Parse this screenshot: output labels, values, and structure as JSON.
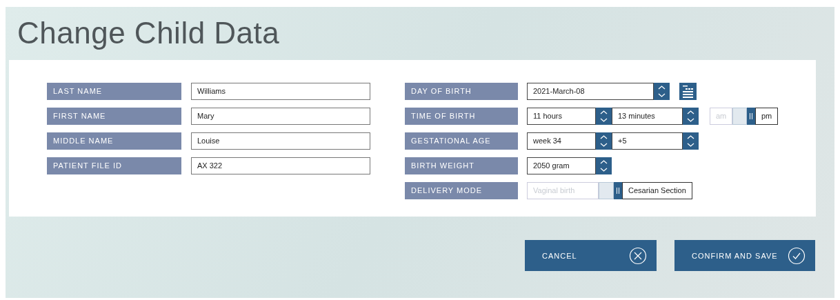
{
  "title": "Change Child Data",
  "left_fields": [
    {
      "label": "LAST NAME",
      "value": "Williams"
    },
    {
      "label": "FIRST NAME",
      "value": "Mary"
    },
    {
      "label": "MIDDLE NAME",
      "value": "Louise"
    },
    {
      "label": "PATIENT FILE ID",
      "value": "AX 322"
    }
  ],
  "right_fields": [
    {
      "label": "DAY OF BIRTH",
      "kind": "date",
      "value": "2021-March-08"
    },
    {
      "label": "TIME OF BIRTH",
      "kind": "time",
      "spinners": [
        {
          "value": "11 hours"
        },
        {
          "value": "13 minutes"
        }
      ],
      "toggle": [
        {
          "label": "am",
          "selected": false
        },
        {
          "label": "pm",
          "selected": true
        }
      ]
    },
    {
      "label": "GESTATIONAL AGE",
      "kind": "spinners",
      "spinners": [
        {
          "value": "week 34"
        },
        {
          "value": "+5"
        }
      ]
    },
    {
      "label": "BIRTH WEIGHT",
      "kind": "spinners",
      "spinners": [
        {
          "value": "2050 gram"
        }
      ]
    },
    {
      "label": "DELIVERY MODE",
      "kind": "toggle",
      "toggle": [
        {
          "label": "Vaginal birth",
          "selected": false
        },
        {
          "label": "Cesarian Section",
          "selected": true
        }
      ]
    }
  ],
  "buttons": [
    {
      "label": "CANCEL",
      "kind": "cancel"
    },
    {
      "label": "CONFIRM AND SAVE",
      "kind": "confirm"
    }
  ]
}
